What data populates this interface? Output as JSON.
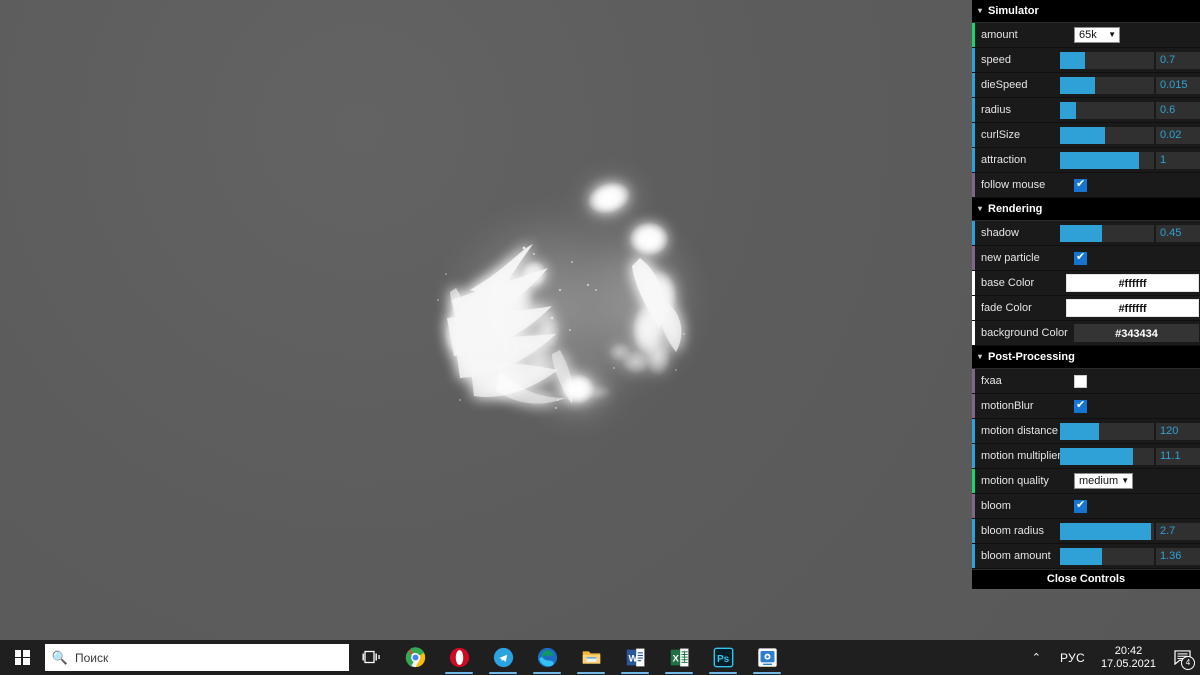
{
  "app": {
    "background_color": "#343434",
    "accent_color": "#2fa1d6"
  },
  "gui": {
    "folders": [
      {
        "title": "Simulator",
        "caret": "▾",
        "rows": [
          {
            "label": "amount",
            "type": "select",
            "value": "65k",
            "marker": "string"
          },
          {
            "label": "speed",
            "type": "slider",
            "value": "0.7",
            "fill": 27,
            "marker": "number"
          },
          {
            "label": "dieSpeed",
            "type": "slider",
            "value": "0.015",
            "fill": 37,
            "marker": "number"
          },
          {
            "label": "radius",
            "type": "slider",
            "value": "0.6",
            "fill": 17,
            "marker": "number"
          },
          {
            "label": "curlSize",
            "type": "slider",
            "value": "0.02",
            "fill": 48,
            "marker": "number"
          },
          {
            "label": "attraction",
            "type": "slider",
            "value": "1",
            "fill": 84,
            "marker": "number"
          },
          {
            "label": "follow mouse",
            "type": "checkbox",
            "value": "checked",
            "marker": "boolean"
          }
        ]
      },
      {
        "title": "Rendering",
        "caret": "▾",
        "rows": [
          {
            "label": "shadow",
            "type": "slider",
            "value": "0.45",
            "fill": 45,
            "marker": "number"
          },
          {
            "label": "new particle",
            "type": "checkbox",
            "value": "checked",
            "marker": "boolean"
          },
          {
            "label": "base Color",
            "type": "color",
            "value": "#ffffff",
            "swatch": "#ffffff",
            "marker": "color"
          },
          {
            "label": "fade Color",
            "type": "color",
            "value": "#ffffff",
            "swatch": "#ffffff",
            "marker": "color"
          },
          {
            "label": "background Color",
            "type": "color-dark",
            "value": "#343434",
            "swatch": "#343434",
            "marker": "color"
          }
        ]
      },
      {
        "title": "Post-Processing",
        "caret": "▾",
        "rows": [
          {
            "label": "fxaa",
            "type": "checkbox",
            "value": "unchecked",
            "marker": "boolean"
          },
          {
            "label": "motionBlur",
            "type": "checkbox",
            "value": "checked",
            "marker": "boolean"
          },
          {
            "label": "motion distance",
            "type": "slider",
            "value": "120",
            "fill": 42,
            "marker": "number"
          },
          {
            "label": "motion multiplier",
            "type": "slider",
            "value": "11.1",
            "fill": 78,
            "marker": "number"
          },
          {
            "label": "motion quality",
            "type": "select",
            "value": "medium",
            "marker": "string"
          },
          {
            "label": "bloom",
            "type": "checkbox",
            "value": "checked",
            "marker": "boolean"
          },
          {
            "label": "bloom radius",
            "type": "slider",
            "value": "2.7",
            "fill": 97,
            "marker": "number"
          },
          {
            "label": "bloom amount",
            "type": "slider",
            "value": "1.36",
            "fill": 45,
            "marker": "number"
          }
        ]
      }
    ],
    "close_controls": "Close Controls"
  },
  "taskbar": {
    "start_icon": "windows-logo-icon",
    "search_placeholder": "Поиск",
    "search_icon": "search-icon",
    "task_view_icon": "task-view-icon",
    "apps": [
      {
        "name": "google-chrome",
        "running": false
      },
      {
        "name": "opera",
        "running": true
      },
      {
        "name": "telegram",
        "running": true
      },
      {
        "name": "microsoft-edge",
        "running": true
      },
      {
        "name": "file-explorer",
        "running": true
      },
      {
        "name": "microsoft-word",
        "running": true
      },
      {
        "name": "microsoft-excel",
        "running": true
      },
      {
        "name": "adobe-photoshop",
        "running": true
      },
      {
        "name": "system-app",
        "running": true
      }
    ],
    "tray": {
      "chevron": "⌃",
      "language": "РУС",
      "time": "20:42",
      "date": "17.05.2021",
      "notification_icon": "notification-icon",
      "notification_count": "4"
    }
  }
}
